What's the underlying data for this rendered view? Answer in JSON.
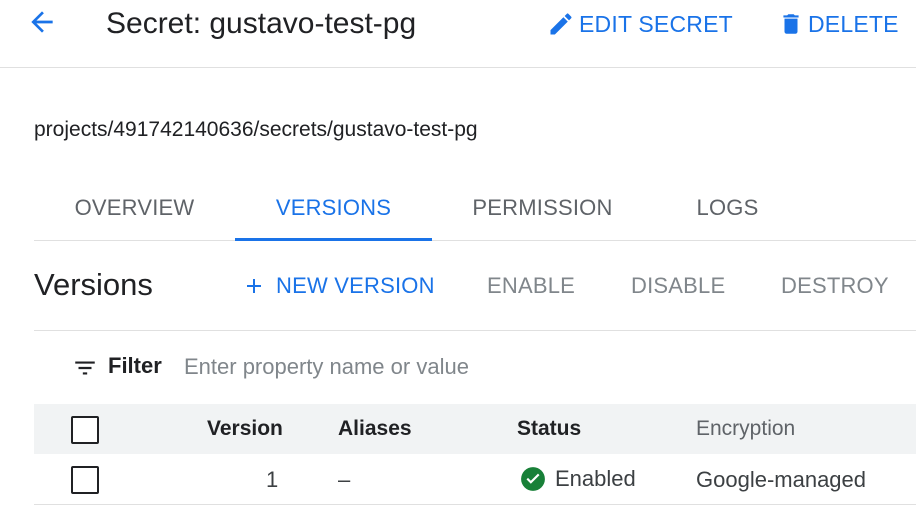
{
  "header": {
    "title": "Secret: gustavo-test-pg",
    "edit_label": "EDIT SECRET",
    "delete_label": "DELETE"
  },
  "resource_path": "projects/491742140636/secrets/gustavo-test-pg",
  "tabs": [
    {
      "label": "OVERVIEW",
      "active": false
    },
    {
      "label": "VERSIONS",
      "active": true
    },
    {
      "label": "PERMISSION",
      "active": false
    },
    {
      "label": "LOGS",
      "active": false
    }
  ],
  "versions": {
    "title": "Versions",
    "new_version_label": "NEW VERSION",
    "enable_label": "ENABLE",
    "disable_label": "DISABLE",
    "destroy_label": "DESTROY"
  },
  "filter": {
    "label": "Filter",
    "placeholder": "Enter property name or value",
    "value": ""
  },
  "table": {
    "columns": [
      "Version",
      "Aliases",
      "Status",
      "Encryption"
    ],
    "rows": [
      {
        "version": "1",
        "aliases": "–",
        "status": "Enabled",
        "encryption": "Google-managed"
      }
    ]
  },
  "colors": {
    "accent": "#1a73e8",
    "status_enabled": "#188038",
    "disabled_text": "#80868b",
    "header_row_bg": "#f1f3f4"
  },
  "icons": {
    "back": "arrow-back-icon",
    "edit": "pencil-icon",
    "delete": "trash-icon",
    "add": "plus-icon",
    "filter": "filter-icon",
    "status": "check-circle-icon"
  }
}
